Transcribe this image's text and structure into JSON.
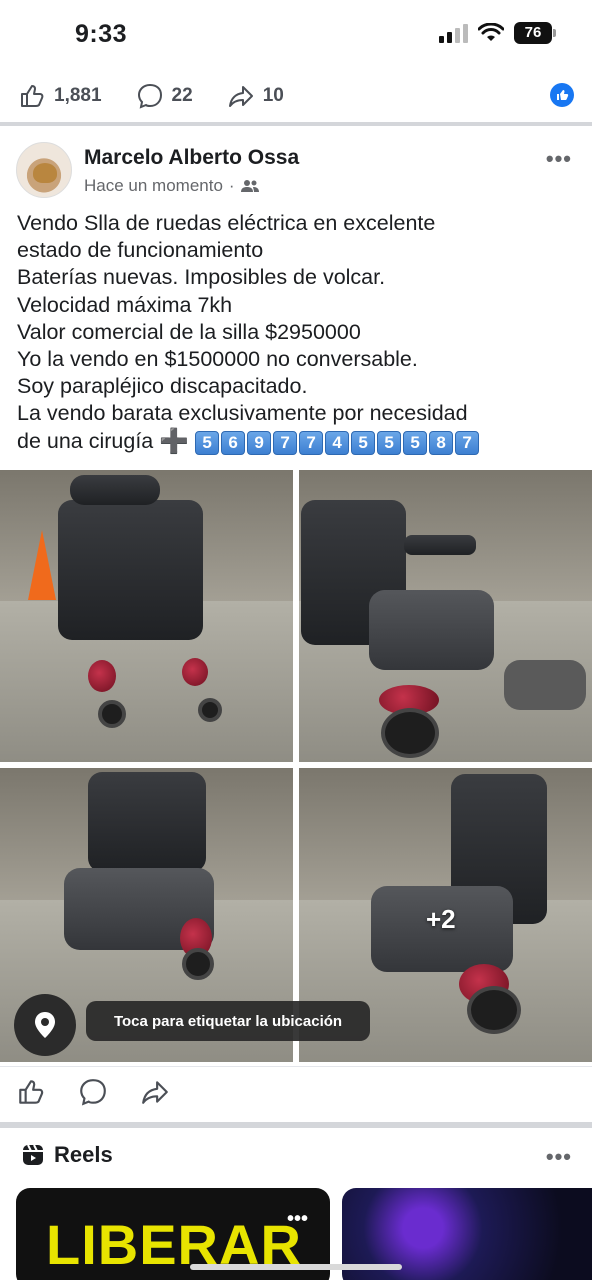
{
  "status_bar": {
    "time": "9:33",
    "battery": "76"
  },
  "reactions_bar": {
    "likes": "1,881",
    "comments": "22",
    "shares": "10"
  },
  "post": {
    "author": "Marcelo Alberto Ossa",
    "timestamp": "Hace un momento",
    "text_lines": [
      "Vendo Slla de ruedas eléctrica en excelente",
      "estado de funcionamiento",
      "Baterías nuevas. Imposibles de volcar.",
      "Velocidad máxima 7kh",
      "Valor comercial de la silla $2950000",
      "Yo la vendo en $1500000 no conversable.",
      "Soy parapléjico discapacitado.",
      "La vendo barata exclusivamente por necesidad",
      "de una cirugía"
    ],
    "phone_plus": "➕",
    "phone_digits": [
      "5",
      "6",
      "9",
      "7",
      "7",
      "4",
      "5",
      "5",
      "5",
      "8",
      "7"
    ],
    "more_photos": "+2",
    "location_prompt": "Toca para etiquetar la ubicación"
  },
  "reels": {
    "title": "Reels",
    "card1_text": "LIBERAR"
  },
  "icons": {
    "like": "thumbs-up-icon",
    "comment": "comment-bubble-icon",
    "share": "share-arrow-icon",
    "location": "location-pin-icon",
    "reels": "reels-icon",
    "audience": "friends-icon"
  },
  "colors": {
    "accent": "#1877f2",
    "keycap": "#3d7fd1",
    "reel_title": "#e8e400"
  }
}
